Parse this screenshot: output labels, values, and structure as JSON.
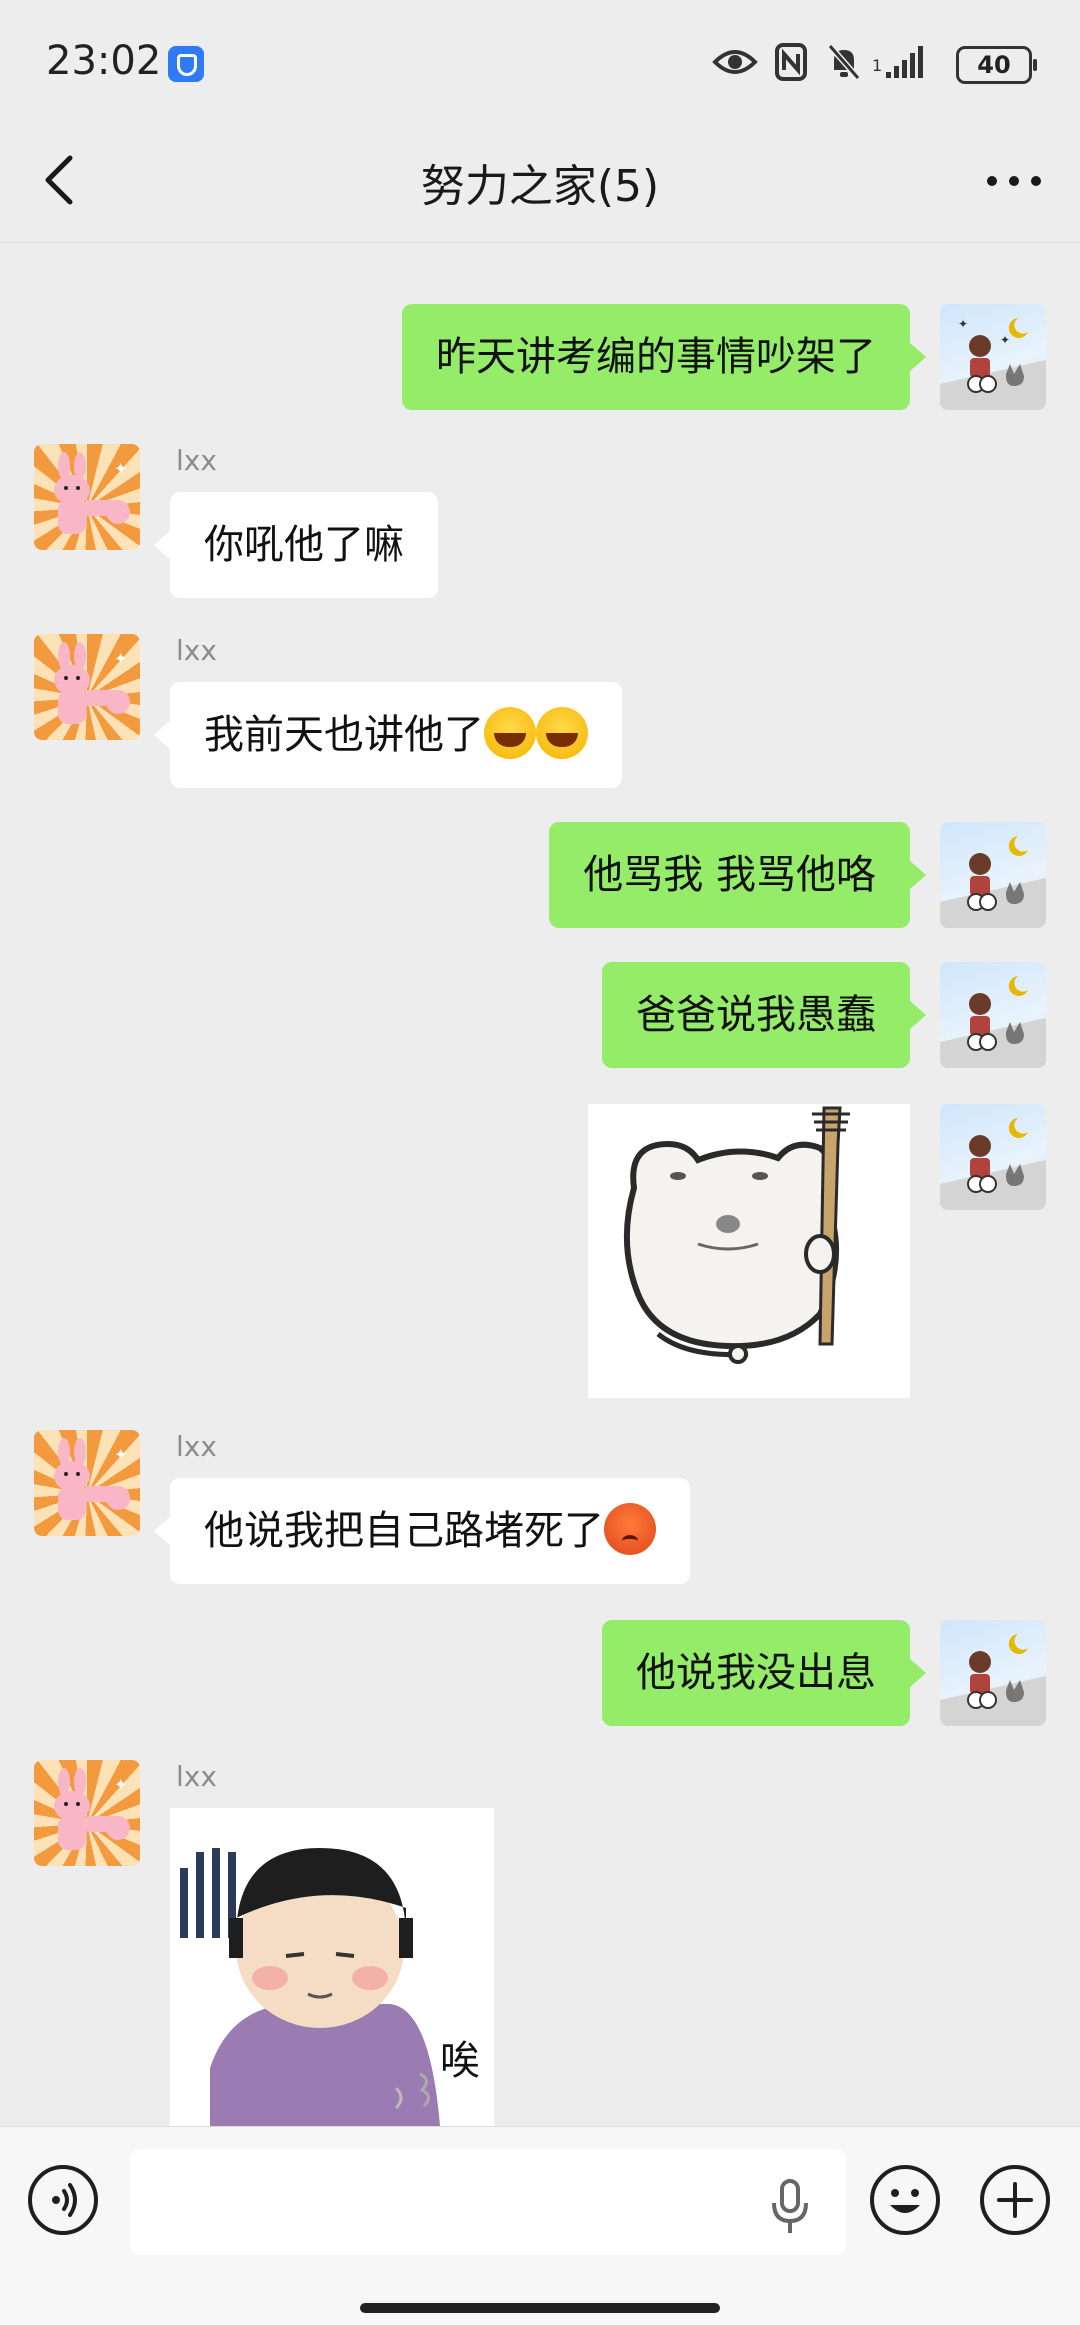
{
  "status_bar": {
    "time": "23:02",
    "battery": "40",
    "signal_label": "1"
  },
  "chat": {
    "title": "努力之家(5)"
  },
  "messages": [
    {
      "from": "me",
      "type": "text",
      "text": "昨天讲考编的事情吵架了"
    },
    {
      "from": "lxx",
      "sender": "lxx",
      "type": "text",
      "text": "你吼他了嘛"
    },
    {
      "from": "lxx",
      "sender": "lxx",
      "type": "text",
      "text": "我前天也讲他了",
      "emoji": [
        "laughing-tears-emoji",
        "laughing-tears-emoji"
      ]
    },
    {
      "from": "me",
      "type": "text",
      "text": "他骂我 我骂他咯"
    },
    {
      "from": "me",
      "type": "text",
      "text": "爸爸说我愚蠢"
    },
    {
      "from": "me",
      "type": "sticker",
      "sticker": "bear-with-rake-sticker"
    },
    {
      "from": "lxx",
      "sender": "lxx",
      "type": "text",
      "text": "他说我把自己路堵死了",
      "emoji": [
        "angry-sweat-emoji"
      ]
    },
    {
      "from": "me",
      "type": "text",
      "text": "他说我没出息"
    },
    {
      "from": "lxx",
      "sender": "lxx",
      "type": "sticker",
      "sticker": "sighing-girl-sticker",
      "caption": "唉"
    }
  ],
  "colors": {
    "background": "#ededed",
    "my_bubble": "#95ec69",
    "other_bubble": "#ffffff"
  }
}
